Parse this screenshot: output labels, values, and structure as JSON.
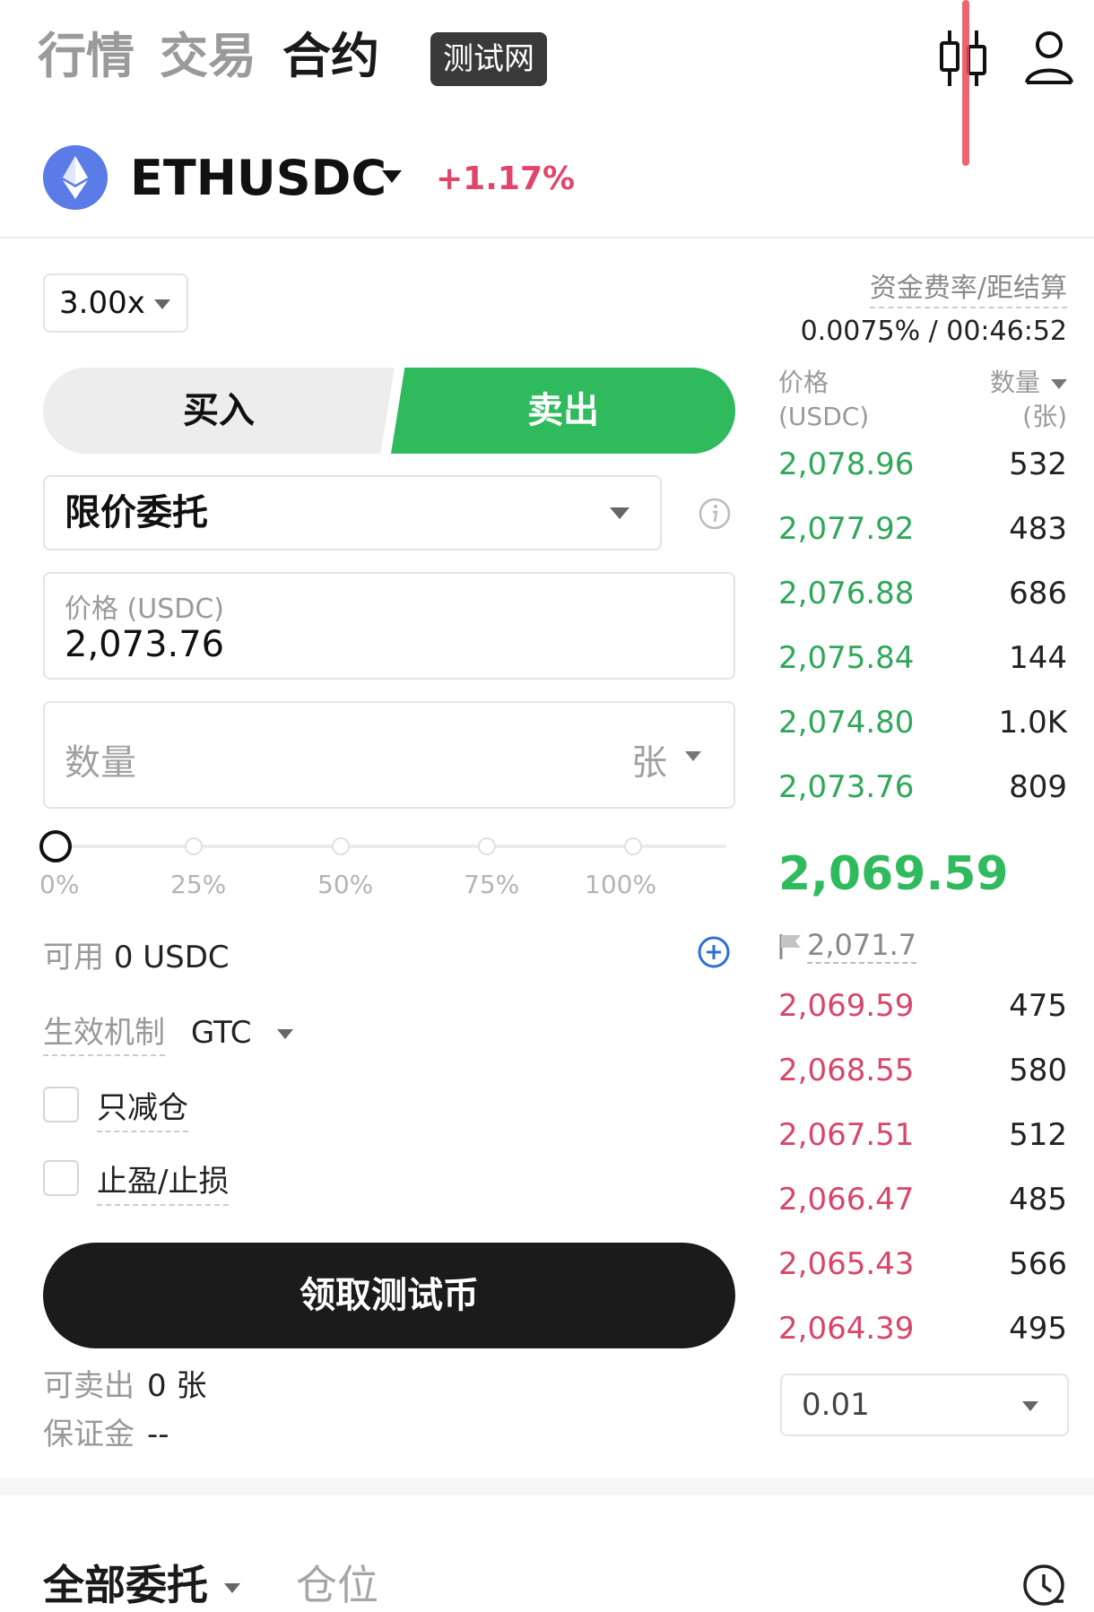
{
  "nav": {
    "tabs": [
      "行情",
      "交易",
      "合约"
    ],
    "testnet_badge": "测试网",
    "icons": [
      "kline-icon",
      "user-icon"
    ]
  },
  "symbol": {
    "name": "ETHUSDC",
    "change": "+1.17%",
    "icon": "ethereum-logo"
  },
  "form": {
    "leverage": "3.00x",
    "buy_label": "买入",
    "sell_label": "卖出",
    "order_type": "限价委托",
    "price_label": "价格 (USDC)",
    "price_value": "2,073.76",
    "qty_placeholder": "数量",
    "qty_unit": "张",
    "slider_labels": [
      "0%",
      "25%",
      "50%",
      "75%",
      "100%"
    ],
    "slider_value_percent": 0,
    "available_label": "可用",
    "available_value": "0 USDC",
    "tif_label": "生效机制",
    "tif_value": "GTC",
    "reduce_only": "只减仓",
    "tp_sl": "止盈/止损",
    "claim_button": "领取测试币",
    "sellable_label": "可卖出",
    "sellable_value": "0 张",
    "margin_label": "保证金",
    "margin_value": "--"
  },
  "funding": {
    "label": "资金费率/距结算",
    "value": "0.0075% / 00:46:52"
  },
  "orderbook": {
    "price_header": "价格",
    "price_unit": "(USDC)",
    "qty_header": "数量",
    "qty_unit": "(张)",
    "asks": [
      {
        "price": "2,078.96",
        "qty": "532"
      },
      {
        "price": "2,077.92",
        "qty": "483"
      },
      {
        "price": "2,076.88",
        "qty": "686"
      },
      {
        "price": "2,075.84",
        "qty": "144"
      },
      {
        "price": "2,074.80",
        "qty": "1.0K"
      },
      {
        "price": "2,073.76",
        "qty": "809"
      }
    ],
    "last_price": "2,069.59",
    "mark_price": "2,071.7",
    "bids": [
      {
        "price": "2,069.59",
        "qty": "475"
      },
      {
        "price": "2,068.55",
        "qty": "580"
      },
      {
        "price": "2,067.51",
        "qty": "512"
      },
      {
        "price": "2,066.47",
        "qty": "485"
      },
      {
        "price": "2,065.43",
        "qty": "566"
      },
      {
        "price": "2,064.39",
        "qty": "495"
      }
    ],
    "precision": "0.01"
  },
  "bottom": {
    "tab_orders": "全部委托",
    "tab_positions": "仓位"
  },
  "colors": {
    "ask_green": "#2fa85a",
    "bid_red": "#d8466a",
    "sell_button": "#2fba5d",
    "change_red": "#e2456a"
  }
}
